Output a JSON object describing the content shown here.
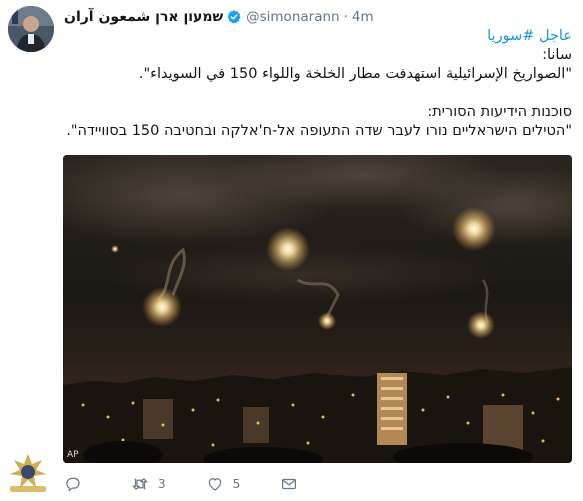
{
  "tweet": {
    "display_name": "שמעון ארן شمعون آران",
    "handle": "@simonarann",
    "separator": "·",
    "time": "4m",
    "hashtag": "عاجل #سوريا",
    "line_sana_label": "سانا:",
    "line_sana_quote": "\"الصواريخ الإسرائيلية استهدفت مطار الخلخة واللواء 150 في السويداء\".",
    "line_he_label": "סוכנות הידיעות הסורית:",
    "line_he_quote": "\"הטילים הישראליים נורו לעבר שדה התעופה אל-ח'אלקה ובחטיבה 150 בסוויידה\".",
    "media_credit": "AP"
  },
  "actions": {
    "reply_count": "",
    "retweet_count": "3",
    "like_count": "5"
  },
  "icons": {
    "verified": "verified-badge-icon",
    "reply": "reply-icon",
    "retweet": "retweet-icon",
    "like": "heart-icon",
    "dm": "envelope-icon"
  },
  "colors": {
    "link": "#1b95e0",
    "secondary_text": "#657786",
    "primary_text": "#14171a"
  }
}
